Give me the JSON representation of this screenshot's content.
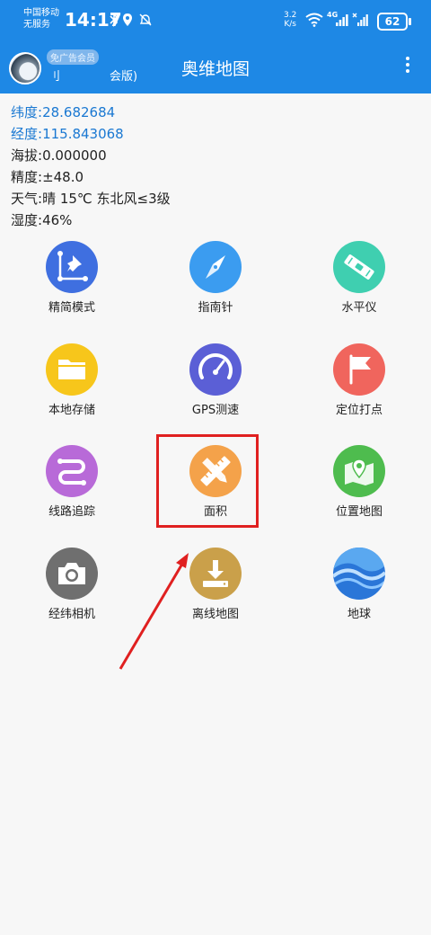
{
  "status_bar": {
    "carrier_line1": "中国移动",
    "carrier_line2": "无服务",
    "time": "14:17",
    "speed_value": "3.2",
    "speed_unit": "K/s",
    "signal_label": "4G",
    "battery": "62"
  },
  "header": {
    "member_tag": "免广告会员",
    "user_name": "刂",
    "member_suffix": "会版)",
    "title": "奥维地图"
  },
  "location_info": {
    "lat_label": "纬度:",
    "lat_value": "28.682684",
    "lng_label": "经度:",
    "lng_value": "115.843068",
    "alt_label": "海拔:",
    "alt_value": "0.000000",
    "acc_label": "精度:",
    "acc_value": "±48.0",
    "weather_label": "天气:",
    "weather_value": "晴  15℃  东北风≤3级",
    "humidity_label": "湿度:",
    "humidity_value": "46%"
  },
  "tools": [
    {
      "label": "精简模式",
      "icon": "pin-crop-icon",
      "color": "#3f6fe0"
    },
    {
      "label": "指南针",
      "icon": "compass-icon",
      "color": "#3b9cf0"
    },
    {
      "label": "水平仪",
      "icon": "level-icon",
      "color": "#3fcfb0"
    },
    {
      "label": "本地存储",
      "icon": "folder-icon",
      "color": "#f7c61b"
    },
    {
      "label": "GPS测速",
      "icon": "speedometer-icon",
      "color": "#5b5fd6"
    },
    {
      "label": "定位打点",
      "icon": "flag-icon",
      "color": "#f0655d"
    },
    {
      "label": "线路追踪",
      "icon": "route-icon",
      "color": "#b86ad8"
    },
    {
      "label": "面积",
      "icon": "ruler-pencil-icon",
      "color": "#f4a24a"
    },
    {
      "label": "位置地图",
      "icon": "map-marker-icon",
      "color": "#4ebc4e"
    },
    {
      "label": "经纬相机",
      "icon": "camera-icon",
      "color": "#6f6f6f"
    },
    {
      "label": "离线地图",
      "icon": "download-icon",
      "color": "#caa04a"
    },
    {
      "label": "地球",
      "icon": "globe-waves-icon",
      "color": "#2a76d8"
    }
  ]
}
